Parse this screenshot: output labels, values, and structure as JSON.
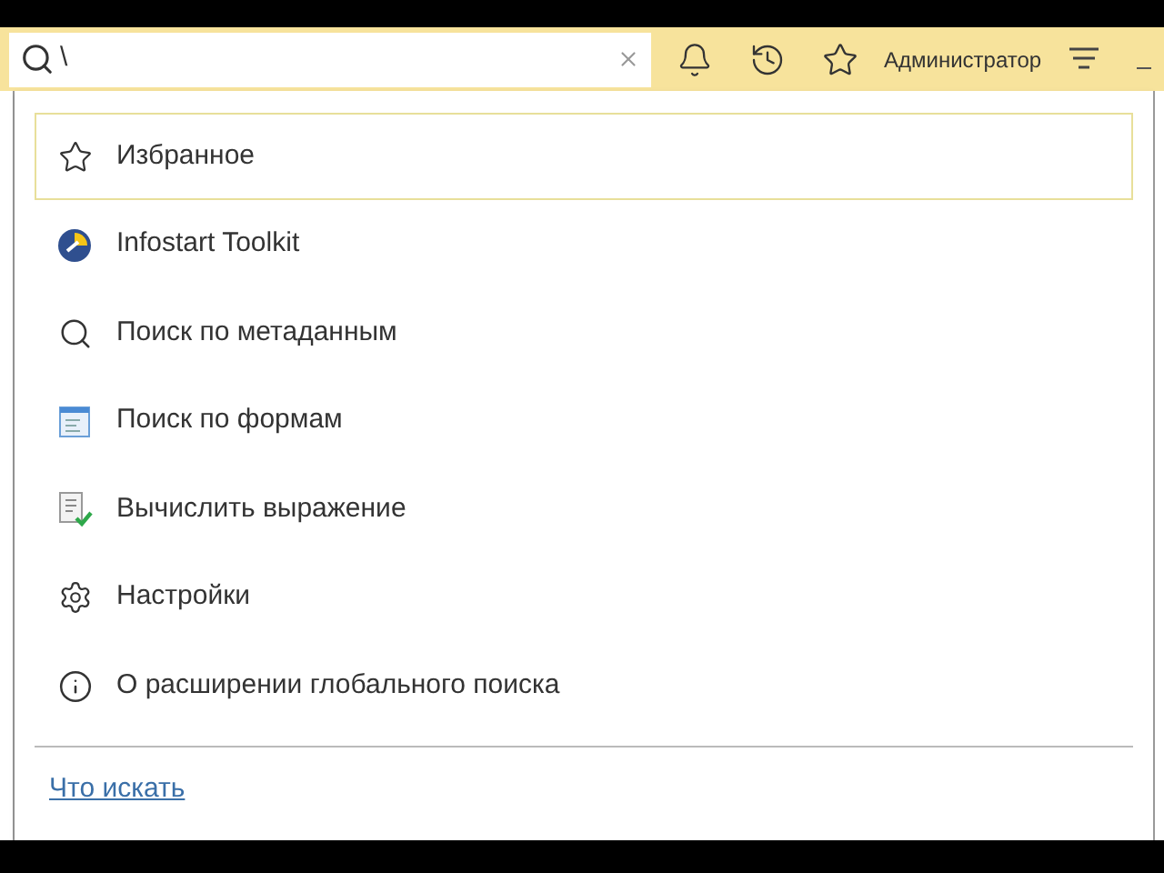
{
  "search": {
    "value": "\\"
  },
  "header": {
    "user": "Администратор"
  },
  "menu": {
    "items": [
      {
        "kind": "star",
        "label": "Избранное",
        "selected": true
      },
      {
        "kind": "toolkit",
        "label": "Infostart Toolkit",
        "selected": false
      },
      {
        "kind": "search",
        "label": "Поиск по метаданным",
        "selected": false
      },
      {
        "kind": "form",
        "label": "Поиск по формам",
        "selected": false
      },
      {
        "kind": "eval",
        "label": "Вычислить выражение",
        "selected": false
      },
      {
        "kind": "gear",
        "label": "Настройки",
        "selected": false
      },
      {
        "kind": "info",
        "label": "О расширении глобального поиска",
        "selected": false
      }
    ],
    "footer_link": "Что искать"
  }
}
